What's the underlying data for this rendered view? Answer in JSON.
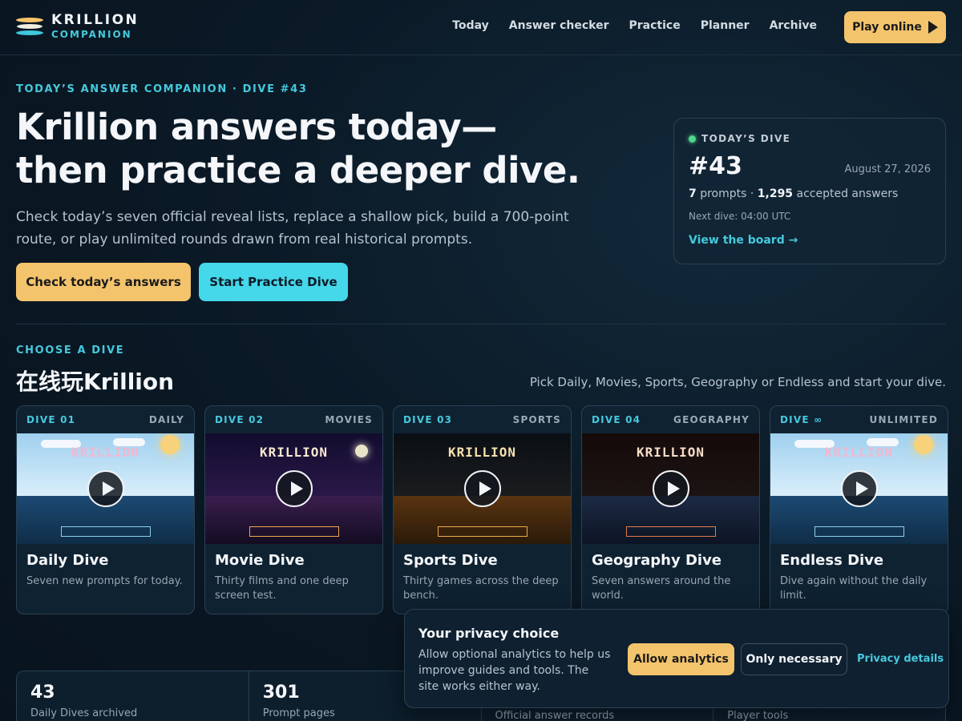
{
  "brand": {
    "name": "KRILLION",
    "sub": "COMPANION"
  },
  "nav": {
    "items": [
      "Today",
      "Answer checker",
      "Practice",
      "Planner",
      "Archive"
    ],
    "cta": "Play online"
  },
  "hero": {
    "eyebrow": "TODAY’S ANSWER COMPANION · DIVE #43",
    "title_line1": "Krillion answers today—",
    "title_line2": "then practice a deeper dive.",
    "subtitle": "Check today’s seven official reveal lists, replace a shallow pick, build a 700-point route, or play unlimited rounds drawn from real historical prompts.",
    "primary_button": "Check today’s answers",
    "secondary_button": "Start Practice Dive"
  },
  "today": {
    "label": "TODAY’S DIVE",
    "number": "#43",
    "date": "August 27, 2026",
    "prompts": "7",
    "prompts_label": "prompts ·",
    "answers": "1,295",
    "answers_label": "accepted answers",
    "next": "Next dive: 04:00 UTC",
    "link": "View the board →"
  },
  "dives": {
    "eyebrow": "CHOOSE A DIVE",
    "title": "在线玩Krillion",
    "subtitle": "Pick Daily, Movies, Sports, Geography or Endless and start your dive.",
    "cards": [
      {
        "num": "DIVE 01",
        "cat": "DAILY",
        "title": "Daily Dive",
        "desc": "Seven new prompts for today.",
        "thumb_word": "KRILLION",
        "theme": "daily"
      },
      {
        "num": "DIVE 02",
        "cat": "MOVIES",
        "title": "Movie Dive",
        "desc": "Thirty films and one deep screen test.",
        "thumb_word": "KRILLION",
        "theme": "movies"
      },
      {
        "num": "DIVE 03",
        "cat": "SPORTS",
        "title": "Sports Dive",
        "desc": "Thirty games across the deep bench.",
        "thumb_word": "KRILLION",
        "theme": "sports"
      },
      {
        "num": "DIVE 04",
        "cat": "GEOGRAPHY",
        "title": "Geography Dive",
        "desc": "Seven answers around the world.",
        "thumb_word": "KRILLION",
        "theme": "geography"
      },
      {
        "num": "DIVE ∞",
        "cat": "UNLIMITED",
        "title": "Endless Dive",
        "desc": "Dive again without the daily limit.",
        "thumb_word": "KRILLION",
        "theme": "endless"
      }
    ]
  },
  "stats": [
    {
      "value": "43",
      "label": "Daily Dives archived"
    },
    {
      "value": "301",
      "label": "Prompt pages"
    },
    {
      "value": "",
      "label": "Official answer records"
    },
    {
      "value": "",
      "label": "Player tools"
    }
  ],
  "privacy": {
    "title": "Your privacy choice",
    "desc": "Allow optional analytics to help us improve guides and tools. The site works either way.",
    "allow": "Allow analytics",
    "necessary": "Only necessary",
    "details": "Privacy details"
  },
  "colors": {
    "accent_yellow": "#f4c46c",
    "accent_cyan": "#45c9dd",
    "bg": "#0b1a27"
  }
}
